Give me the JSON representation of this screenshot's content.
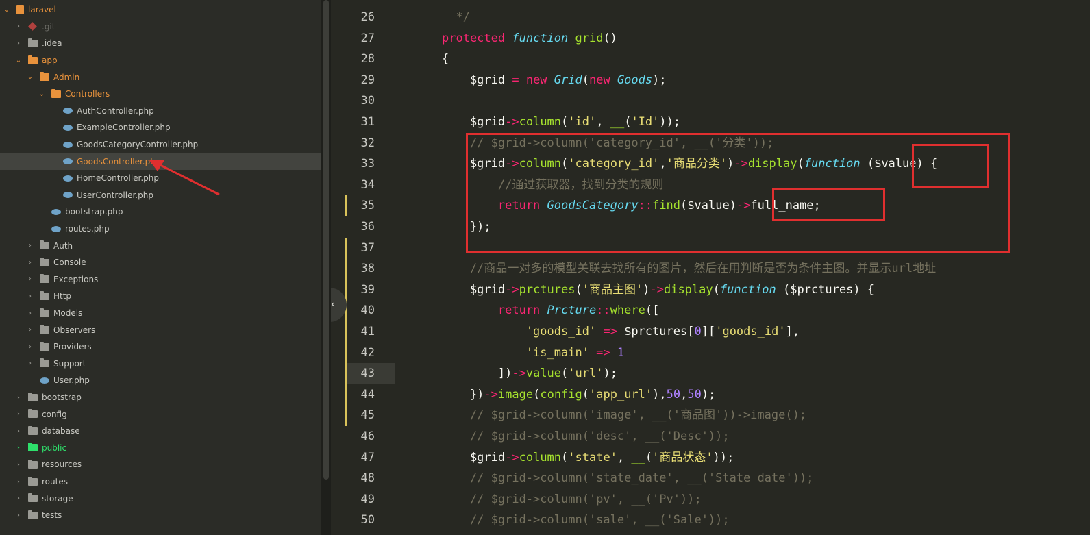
{
  "sidebar": {
    "items": [
      {
        "label": "laravel",
        "depth": 0,
        "arrow": "open",
        "icon": "book-icon",
        "color": "orange"
      },
      {
        "label": ".git",
        "depth": 1,
        "arrow": "closed",
        "icon": "git-icon",
        "color": "dim"
      },
      {
        "label": ".idea",
        "depth": 1,
        "arrow": "closed",
        "icon": "folder-icon",
        "color": "normal"
      },
      {
        "label": "app",
        "depth": 1,
        "arrow": "open",
        "icon": "folder-icon",
        "color": "orange"
      },
      {
        "label": "Admin",
        "depth": 2,
        "arrow": "open",
        "icon": "folder-icon",
        "color": "orange"
      },
      {
        "label": "Controllers",
        "depth": 3,
        "arrow": "open",
        "icon": "folder-icon",
        "color": "orange"
      },
      {
        "label": "AuthController.php",
        "depth": 4,
        "arrow": "none",
        "icon": "php-icon",
        "color": "normal"
      },
      {
        "label": "ExampleController.php",
        "depth": 4,
        "arrow": "none",
        "icon": "php-icon",
        "color": "normal"
      },
      {
        "label": "GoodsCategoryController.php",
        "depth": 4,
        "arrow": "none",
        "icon": "php-icon",
        "color": "normal"
      },
      {
        "label": "GoodsController.php",
        "depth": 4,
        "arrow": "none",
        "icon": "php-icon",
        "color": "orange",
        "selected": true
      },
      {
        "label": "HomeController.php",
        "depth": 4,
        "arrow": "none",
        "icon": "php-icon",
        "color": "normal"
      },
      {
        "label": "UserController.php",
        "depth": 4,
        "arrow": "none",
        "icon": "php-icon",
        "color": "normal"
      },
      {
        "label": "bootstrap.php",
        "depth": 3,
        "arrow": "none",
        "icon": "php-icon",
        "color": "normal"
      },
      {
        "label": "routes.php",
        "depth": 3,
        "arrow": "none",
        "icon": "php-icon",
        "color": "normal"
      },
      {
        "label": "Auth",
        "depth": 2,
        "arrow": "closed",
        "icon": "folder-icon",
        "color": "normal"
      },
      {
        "label": "Console",
        "depth": 2,
        "arrow": "closed",
        "icon": "folder-icon",
        "color": "normal"
      },
      {
        "label": "Exceptions",
        "depth": 2,
        "arrow": "closed",
        "icon": "folder-icon",
        "color": "normal"
      },
      {
        "label": "Http",
        "depth": 2,
        "arrow": "closed",
        "icon": "folder-icon",
        "color": "normal"
      },
      {
        "label": "Models",
        "depth": 2,
        "arrow": "closed",
        "icon": "folder-icon",
        "color": "normal"
      },
      {
        "label": "Observers",
        "depth": 2,
        "arrow": "closed",
        "icon": "folder-icon",
        "color": "normal"
      },
      {
        "label": "Providers",
        "depth": 2,
        "arrow": "closed",
        "icon": "folder-icon",
        "color": "normal"
      },
      {
        "label": "Support",
        "depth": 2,
        "arrow": "closed",
        "icon": "folder-icon",
        "color": "normal"
      },
      {
        "label": "User.php",
        "depth": 2,
        "arrow": "none",
        "icon": "php-icon",
        "color": "normal"
      },
      {
        "label": "bootstrap",
        "depth": 1,
        "arrow": "closed",
        "icon": "folder-icon",
        "color": "normal"
      },
      {
        "label": "config",
        "depth": 1,
        "arrow": "closed",
        "icon": "folder-icon",
        "color": "normal"
      },
      {
        "label": "database",
        "depth": 1,
        "arrow": "closed",
        "icon": "folder-icon",
        "color": "normal"
      },
      {
        "label": "public",
        "depth": 1,
        "arrow": "closed-green",
        "icon": "folder-icon",
        "color": "green"
      },
      {
        "label": "resources",
        "depth": 1,
        "arrow": "closed",
        "icon": "folder-icon",
        "color": "normal"
      },
      {
        "label": "routes",
        "depth": 1,
        "arrow": "closed",
        "icon": "folder-icon",
        "color": "normal"
      },
      {
        "label": "storage",
        "depth": 1,
        "arrow": "closed",
        "icon": "folder-icon",
        "color": "normal"
      },
      {
        "label": "tests",
        "depth": 1,
        "arrow": "closed",
        "icon": "folder-icon",
        "color": "normal"
      }
    ]
  },
  "editor": {
    "collapse_icon": "chevron-left-icon",
    "highlighted_line": 43,
    "lines": [
      {
        "n": "26",
        "tokens": [
          [
            "cm",
            "  */"
          ]
        ]
      },
      {
        "n": "27",
        "tokens": [
          [
            "kw",
            "protected "
          ],
          [
            "it",
            "function "
          ],
          [
            "fn",
            "grid"
          ],
          [
            "wh",
            "()"
          ]
        ]
      },
      {
        "n": "28",
        "tokens": [
          [
            "wh",
            "{"
          ]
        ]
      },
      {
        "n": "29",
        "tokens": [
          [
            "wh",
            "    $grid "
          ],
          [
            "kw",
            "= new "
          ],
          [
            "it",
            "Grid"
          ],
          [
            "wh",
            "("
          ],
          [
            "kw",
            "new "
          ],
          [
            "it",
            "Goods"
          ],
          [
            "wh",
            ");"
          ]
        ]
      },
      {
        "n": "30",
        "tokens": []
      },
      {
        "n": "31",
        "tokens": [
          [
            "wh",
            "    $grid"
          ],
          [
            "kw",
            "->"
          ],
          [
            "fn",
            "column"
          ],
          [
            "wh",
            "("
          ],
          [
            "str",
            "'id'"
          ],
          [
            "wh",
            ", "
          ],
          [
            "fn",
            "__"
          ],
          [
            "wh",
            "("
          ],
          [
            "str",
            "'Id'"
          ],
          [
            "wh",
            "));"
          ]
        ]
      },
      {
        "n": "32",
        "tokens": [
          [
            "cm",
            "    // $grid->column('category_id', __('分类'));"
          ]
        ]
      },
      {
        "n": "33",
        "tokens": [
          [
            "wh",
            "    $grid"
          ],
          [
            "kw",
            "->"
          ],
          [
            "fn",
            "column"
          ],
          [
            "wh",
            "("
          ],
          [
            "str",
            "'category_id'"
          ],
          [
            "wh",
            ","
          ],
          [
            "str",
            "'商品分类'"
          ],
          [
            "wh",
            ")"
          ],
          [
            "kw",
            "->"
          ],
          [
            "fn",
            "display"
          ],
          [
            "wh",
            "("
          ],
          [
            "it",
            "function "
          ],
          [
            "wh",
            "($value) {"
          ]
        ]
      },
      {
        "n": "34",
        "tokens": [
          [
            "cm",
            "        //通过获取器，找到分类的规则"
          ]
        ]
      },
      {
        "n": "35",
        "tokens": [
          [
            "kw",
            "        return "
          ],
          [
            "it",
            "GoodsCategory"
          ],
          [
            "kw",
            "::"
          ],
          [
            "fn",
            "find"
          ],
          [
            "wh",
            "($value)"
          ],
          [
            "kw",
            "->"
          ],
          [
            "wh",
            "full_name;"
          ]
        ]
      },
      {
        "n": "36",
        "tokens": [
          [
            "wh",
            "    });"
          ]
        ]
      },
      {
        "n": "37",
        "tokens": []
      },
      {
        "n": "38",
        "tokens": [
          [
            "cm",
            "    //商品一对多的模型关联去找所有的图片，然后在用判断是否为条件主图。并显示url地址"
          ]
        ]
      },
      {
        "n": "39",
        "tokens": [
          [
            "wh",
            "    $grid"
          ],
          [
            "kw",
            "->"
          ],
          [
            "fn",
            "prctures"
          ],
          [
            "wh",
            "("
          ],
          [
            "str",
            "'商品主图'"
          ],
          [
            "wh",
            ")"
          ],
          [
            "kw",
            "->"
          ],
          [
            "fn",
            "display"
          ],
          [
            "wh",
            "("
          ],
          [
            "it",
            "function "
          ],
          [
            "wh",
            "($prctures) {"
          ]
        ]
      },
      {
        "n": "40",
        "tokens": [
          [
            "kw",
            "        return "
          ],
          [
            "it",
            "Prcture"
          ],
          [
            "kw",
            "::"
          ],
          [
            "fn",
            "where"
          ],
          [
            "wh",
            "(["
          ]
        ]
      },
      {
        "n": "41",
        "tokens": [
          [
            "str",
            "            'goods_id'"
          ],
          [
            "kw",
            " => "
          ],
          [
            "wh",
            "$prctures["
          ],
          [
            "num",
            "0"
          ],
          [
            "wh",
            "]["
          ],
          [
            "str",
            "'goods_id'"
          ],
          [
            "wh",
            "],"
          ]
        ]
      },
      {
        "n": "42",
        "tokens": [
          [
            "str",
            "            'is_main'"
          ],
          [
            "kw",
            " => "
          ],
          [
            "num",
            "1"
          ]
        ]
      },
      {
        "n": "43",
        "tokens": [
          [
            "wh",
            "        ])"
          ],
          [
            "kw",
            "->"
          ],
          [
            "fn",
            "value"
          ],
          [
            "wh",
            "("
          ],
          [
            "str",
            "'url'"
          ],
          [
            "wh",
            ");"
          ]
        ]
      },
      {
        "n": "44",
        "tokens": [
          [
            "wh",
            "    })"
          ],
          [
            "kw",
            "->"
          ],
          [
            "fn",
            "image"
          ],
          [
            "wh",
            "("
          ],
          [
            "fn",
            "config"
          ],
          [
            "wh",
            "("
          ],
          [
            "str",
            "'app_url'"
          ],
          [
            "wh",
            "),"
          ],
          [
            "num",
            "50"
          ],
          [
            "wh",
            ","
          ],
          [
            "num",
            "50"
          ],
          [
            "wh",
            ");"
          ]
        ]
      },
      {
        "n": "45",
        "tokens": [
          [
            "cm",
            "    // $grid->column('image', __('商品图'))->image();"
          ]
        ]
      },
      {
        "n": "46",
        "tokens": [
          [
            "cm",
            "    // $grid->column('desc', __('Desc'));"
          ]
        ]
      },
      {
        "n": "47",
        "tokens": [
          [
            "wh",
            "    $grid"
          ],
          [
            "kw",
            "->"
          ],
          [
            "fn",
            "column"
          ],
          [
            "wh",
            "("
          ],
          [
            "str",
            "'state'"
          ],
          [
            "wh",
            ", "
          ],
          [
            "fn",
            "__"
          ],
          [
            "wh",
            "("
          ],
          [
            "str",
            "'商品状态'"
          ],
          [
            "wh",
            "));"
          ]
        ]
      },
      {
        "n": "48",
        "tokens": [
          [
            "cm",
            "    // $grid->column('state_date', __('State date'));"
          ]
        ]
      },
      {
        "n": "49",
        "tokens": [
          [
            "cm",
            "    // $grid->column('pv', __('Pv'));"
          ]
        ]
      },
      {
        "n": "50",
        "tokens": [
          [
            "cm",
            "    // $grid->column('sale', __('Sale'));"
          ]
        ]
      }
    ]
  },
  "colors": {
    "annotation_red": "#e02f2f",
    "accent_orange": "#e8923c",
    "public_green": "#2ee06b"
  }
}
